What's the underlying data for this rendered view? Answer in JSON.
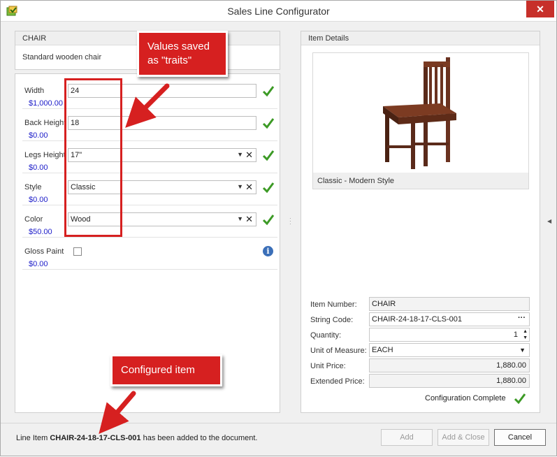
{
  "window": {
    "title": "Sales Line Configurator",
    "close_glyph": "✕"
  },
  "item_panel": {
    "item_code": "CHAIR",
    "description": "Standard wooden chair"
  },
  "options": [
    {
      "label": "Width",
      "price": "$1,000.00",
      "value": "24",
      "type": "text",
      "complete": true
    },
    {
      "label": "Back Height",
      "price": "$0.00",
      "value": "18",
      "type": "text",
      "complete": true
    },
    {
      "label": "Legs Height",
      "price": "$0.00",
      "value": "17\"",
      "type": "combo",
      "complete": true
    },
    {
      "label": "Style",
      "price": "$0.00",
      "value": "Classic",
      "type": "combo",
      "complete": true
    },
    {
      "label": "Color",
      "price": "$50.00",
      "value": "Wood",
      "type": "combo",
      "complete": true
    },
    {
      "label": "Gloss Paint",
      "price": "$0.00",
      "type": "checkbox",
      "checked": false,
      "info_glyph": "i"
    }
  ],
  "item_details": {
    "heading": "Item Details",
    "image_caption": "Classic - Modern Style",
    "item_number_label": "Item Number:",
    "item_number": "CHAIR",
    "string_code_label": "String Code:",
    "string_code": "CHAIR-24-18-17-CLS-001",
    "quantity_label": "Quantity:",
    "quantity": "1",
    "uom_label": "Unit of Measure:",
    "uom": "EACH",
    "unit_price_label": "Unit Price:",
    "unit_price": "1,880.00",
    "extended_price_label": "Extended Price:",
    "extended_price": "1,880.00",
    "status": "Configuration Complete"
  },
  "footer": {
    "msg_prefix": "Line Item ",
    "msg_code": "CHAIR-24-18-17-CLS-001",
    "msg_suffix": " has been added to the document.",
    "add_label": "Add",
    "add_close_label": "Add & Close",
    "cancel_label": "Cancel"
  },
  "annotations": {
    "traits_callout_line1": "Values saved",
    "traits_callout_line2": "as \"traits\"",
    "configured_callout": "Configured item",
    "accent_color": "#d62020"
  },
  "glyphs": {
    "dropdown": "▼",
    "clear": "✕",
    "ellipsis": "···",
    "spin_up": "▲",
    "spin_down": "▼"
  }
}
